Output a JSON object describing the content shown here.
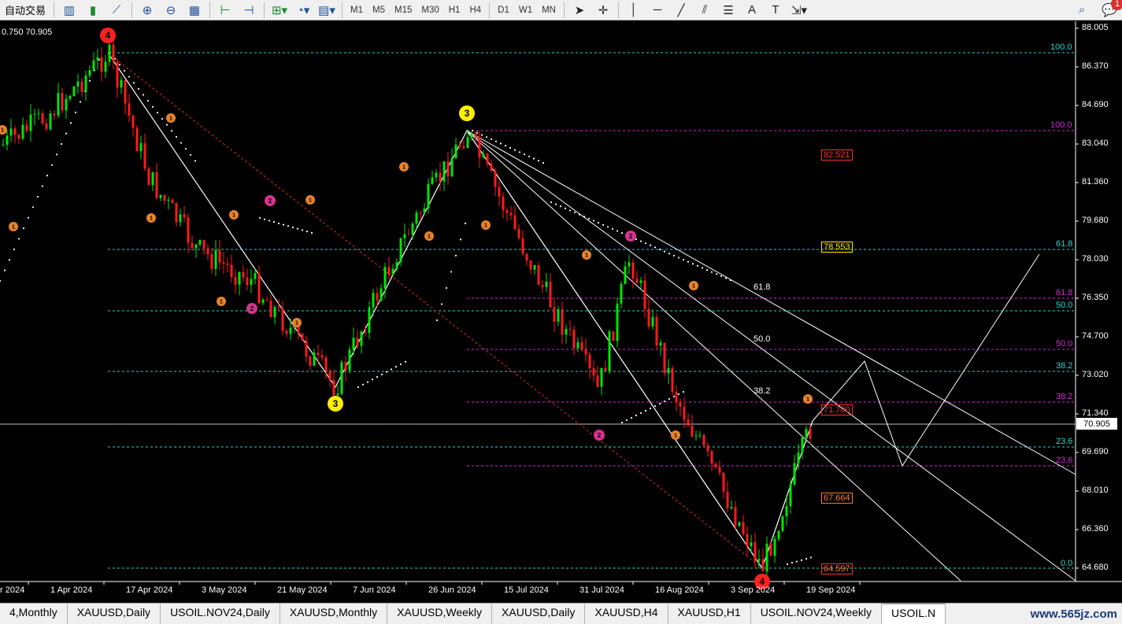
{
  "toolbar": {
    "auto_trading_label": "自动交易",
    "timeframes": [
      "M1",
      "M5",
      "M15",
      "M30",
      "H1",
      "H4",
      "D1",
      "W1",
      "MN"
    ],
    "notification_count": "1"
  },
  "chart": {
    "ohlc_readout": "0.750 70.905",
    "current_price": "70.905",
    "price_axis": [
      "88.005",
      "86.370",
      "84.690",
      "83.040",
      "81.360",
      "79.680",
      "78.030",
      "76.350",
      "74.700",
      "73.020",
      "71.340",
      "69.690",
      "68.010",
      "66.360",
      "64.680"
    ],
    "date_axis": [
      "r 2024",
      "1 Apr 2024",
      "17 Apr 2024",
      "3 May 2024",
      "21 May 2024",
      "7 Jun 2024",
      "26 Jun 2024",
      "15 Jul 2024",
      "31 Jul 2024",
      "16 Aug 2024",
      "3 Sep 2024",
      "19 Sep 2024"
    ],
    "fib_cyan_levels": [
      "100.0",
      "61.8",
      "50.0",
      "38.2",
      "23.6",
      "0.0"
    ],
    "fib_magenta_levels": [
      "100.0",
      "61.8",
      "50.0",
      "38.2",
      "23.6"
    ],
    "fan_levels": [
      "61.8",
      "50.0",
      "38.2"
    ],
    "target_boxes": [
      "82.521",
      "78.553",
      "71.700",
      "67.664",
      "64.597"
    ],
    "wave_labels": {
      "major_top": "4",
      "major_swing_low": "3",
      "major_swing_high": "3",
      "major_bottom": "4",
      "minor": [
        "1",
        "2"
      ]
    }
  },
  "tabs": [
    "4,Monthly",
    "XAUUSD,Daily",
    "USOIL.NOV24,Daily",
    "XAUUSD,Monthly",
    "XAUUSD,Weekly",
    "XAUUSD,Daily",
    "XAUUSD,H4",
    "XAUUSD,H1",
    "USOIL.NOV24,Weekly",
    "USOIL.N"
  ],
  "active_tab_index": 9,
  "watermark": "www.565jz.com",
  "colors": {
    "bull_candle": "#00e600",
    "bear_candle": "#ff1a1a",
    "fib_cyan": "#28d6c8",
    "fib_magenta": "#d629d6",
    "wave_yellow": "#ffee00",
    "wave_red": "#ff2020",
    "wave_orange": "#e8822a",
    "wave_magenta": "#d6338f"
  }
}
